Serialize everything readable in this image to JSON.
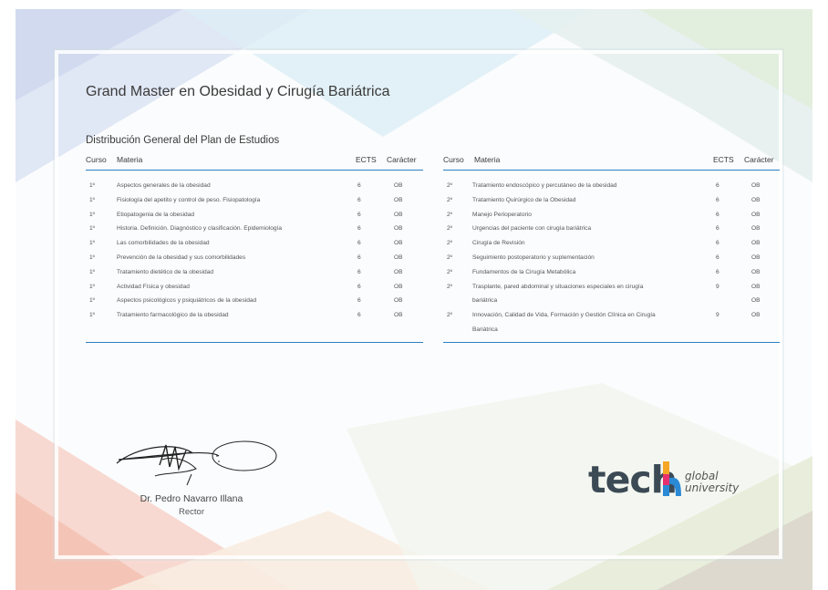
{
  "document": {
    "title": "Grand Master en Obesidad y Cirugía Bariátrica",
    "subtitle": "Distribución General del Plan de Estudios"
  },
  "table": {
    "headers": {
      "curso": "Curso",
      "materia": "Materia",
      "ects": "ECTS",
      "caracter": "Carácter"
    },
    "left_rows": [
      {
        "curso": "1º",
        "materia": "Aspectos generales de la obesidad",
        "ects": "6",
        "caracter": "OB"
      },
      {
        "curso": "1º",
        "materia": "Fisiología del apetito y control de peso. Fisiopatología",
        "ects": "6",
        "caracter": "OB"
      },
      {
        "curso": "1º",
        "materia": "Etiopatogenia de la obesidad",
        "ects": "6",
        "caracter": "OB"
      },
      {
        "curso": "1º",
        "materia": "Historia. Definición. Diagnóstico y clasificación. Epidemiología",
        "ects": "6",
        "caracter": "OB"
      },
      {
        "curso": "1º",
        "materia": "Las comorbilidades de la obesidad",
        "ects": "6",
        "caracter": "OB"
      },
      {
        "curso": "1º",
        "materia": "Prevención de la obesidad y sus comorbilidades",
        "ects": "6",
        "caracter": "OB"
      },
      {
        "curso": "1º",
        "materia": "Tratamiento dietético de la obesidad",
        "ects": "6",
        "caracter": "OB"
      },
      {
        "curso": "1º",
        "materia": "Actividad Física y obesidad",
        "ects": "6",
        "caracter": "OB"
      },
      {
        "curso": "1º",
        "materia": "Aspectos psicológicos y psiquiátricos de la obesidad",
        "ects": "6",
        "caracter": "OB"
      },
      {
        "curso": "1º",
        "materia": "Tratamiento farmacológico de la obesidad",
        "ects": "6",
        "caracter": "OB"
      }
    ],
    "right_rows": [
      {
        "curso": "2º",
        "materia": "Tratamiento endoscópico y percutáneo de la obesidad",
        "ects": "6",
        "caracter": "OB"
      },
      {
        "curso": "2º",
        "materia": "Tratamiento Quirúrgico de la Obesidad",
        "ects": "6",
        "caracter": "OB"
      },
      {
        "curso": "2º",
        "materia": "Manejo Perioperatorio",
        "ects": "6",
        "caracter": "OB"
      },
      {
        "curso": "2º",
        "materia": "Urgencias del paciente con cirugía bariátrica",
        "ects": "6",
        "caracter": "OB"
      },
      {
        "curso": "2º",
        "materia": "Cirugía de Revisión",
        "ects": "6",
        "caracter": "OB"
      },
      {
        "curso": "2º",
        "materia": "Seguimiento postoperatorio y suplementación",
        "ects": "6",
        "caracter": "OB"
      },
      {
        "curso": "2º",
        "materia": "Fundamentos de la Cirugía Metabólica",
        "ects": "6",
        "caracter": "OB"
      },
      {
        "curso": "2º",
        "materia": "Trasplante, pared abdominal y situaciones especiales en cirugía",
        "ects": "9",
        "caracter": "OB"
      },
      {
        "curso": "",
        "materia": "bariátrica",
        "ects": "",
        "caracter": "OB"
      },
      {
        "curso": "2º",
        "materia": "Innovación, Calidad de Vida, Formación y Gestión Clínica en Cirugía",
        "ects": "9",
        "caracter": "OB"
      },
      {
        "curso": "",
        "materia": "Bariátrica",
        "ects": "",
        "caracter": ""
      }
    ]
  },
  "signatory": {
    "name": "Dr. Pedro Navarro Illana",
    "role": "Rector"
  },
  "logo": {
    "wordmark": "tech",
    "sub_line1": "global",
    "sub_line2": "university",
    "colors": {
      "text": "#3b4a55",
      "accent_top": "#f5a623",
      "accent_mid": "#e8306f",
      "accent_bottom": "#2a8ad6"
    }
  }
}
